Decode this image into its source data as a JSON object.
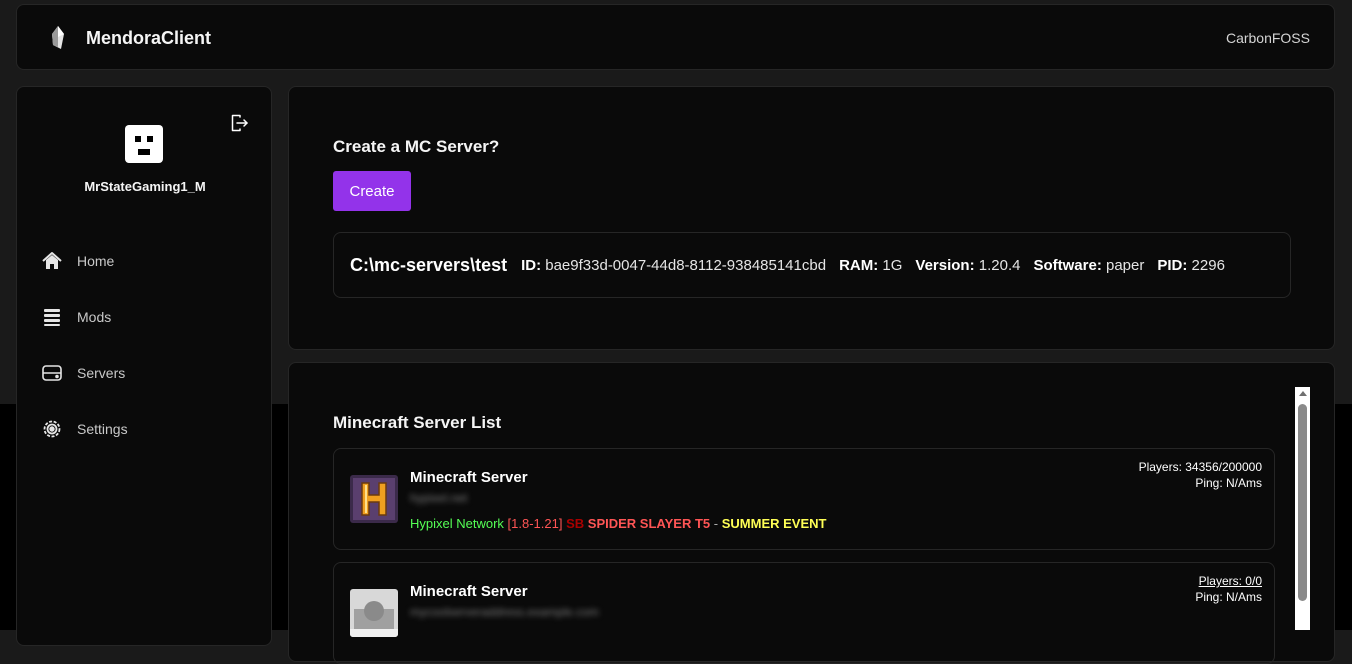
{
  "header": {
    "app_title": "MendoraClient",
    "right_label": "CarbonFOSS"
  },
  "sidebar": {
    "username": "MrStateGaming1_M",
    "items": [
      {
        "label": "Home",
        "icon": "home-icon"
      },
      {
        "label": "Mods",
        "icon": "mods-icon"
      },
      {
        "label": "Servers",
        "icon": "servers-icon"
      },
      {
        "label": "Settings",
        "icon": "settings-icon"
      }
    ]
  },
  "create": {
    "title": "Create a MC Server?",
    "button_label": "Create",
    "server": {
      "path": "C:\\mc-servers\\test",
      "id_label": "ID:",
      "id": "bae9f33d-0047-44d8-8112-938485141cbd",
      "ram_label": "RAM:",
      "ram": "1G",
      "version_label": "Version:",
      "version": "1.20.4",
      "software_label": "Software:",
      "software": "paper",
      "pid_label": "PID:",
      "pid": "2296"
    }
  },
  "server_list": {
    "title": "Minecraft Server List",
    "servers": [
      {
        "name": "Minecraft Server",
        "address": "hypixel.net",
        "players": "Players: 34356/200000",
        "ping": "Ping: N/Ams",
        "motd": {
          "network": "Hypixel Network",
          "versions": "[1.8-1.21]",
          "sb": "SB",
          "event1": "SPIDER SLAYER T5",
          "dash": "-",
          "event2": "SUMMER EVENT"
        }
      },
      {
        "name": "Minecraft Server",
        "address": "mycoolserveraddress.example.com",
        "players": "Players: 0/0",
        "ping": "Ping: N/Ams"
      }
    ]
  },
  "colors": {
    "accent": "#9333ea",
    "panel_bg": "#0a0a0a",
    "border": "#262626",
    "motd_green": "#55ff55",
    "motd_red": "#ff5555",
    "motd_yellow": "#ffff55"
  }
}
